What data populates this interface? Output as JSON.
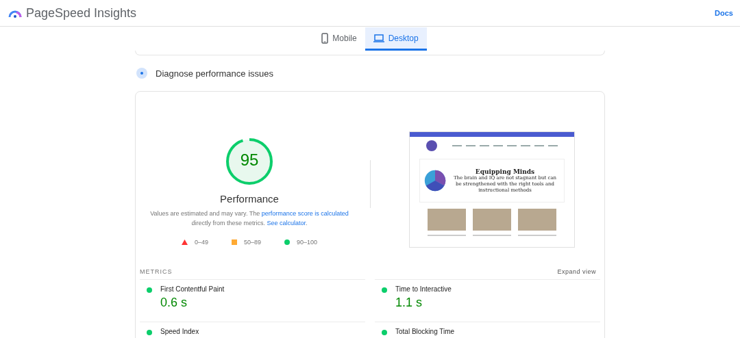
{
  "header": {
    "title": "PageSpeed Insights",
    "docs_link": "Docs"
  },
  "device_tabs": [
    {
      "label": "Mobile",
      "kind": "mobile",
      "selected": false
    },
    {
      "label": "Desktop",
      "kind": "desktop",
      "selected": true
    }
  ],
  "section": {
    "title": "Diagnose performance issues"
  },
  "score": {
    "value": "95",
    "level": 0.95,
    "label": "Performance",
    "note_start": "Values are estimated and may vary. The ",
    "note_link": "performance score is calculated",
    "note_middle": " directly from these metrics. ",
    "note_link_2": "See calculator",
    "note_end": "."
  },
  "legend": [
    {
      "kind": "fail",
      "range": "0–49",
      "color": "#ff3333"
    },
    {
      "kind": "average",
      "range": "50–89",
      "color": "#ffaa33"
    },
    {
      "kind": "pass",
      "range": "90–100",
      "color": "#0cce6b"
    }
  ],
  "preview": {
    "heading": "Equipping Minds",
    "tagline": "The brain and IQ are not stagnant but can be strengthened with the right tools and instructional methods"
  },
  "metrics": {
    "title": "METRICS",
    "expand": "Expand view",
    "items": [
      {
        "name": "First Contentful Paint",
        "value": "0.6 s",
        "color": "#0cce6b"
      },
      {
        "name": "Time to Interactive",
        "value": "1.1 s",
        "color": "#0cce6b"
      },
      {
        "name": "Speed Index",
        "color": "#0cce6b"
      },
      {
        "name": "Total Blocking Time",
        "color": "#0cce6b"
      }
    ]
  }
}
